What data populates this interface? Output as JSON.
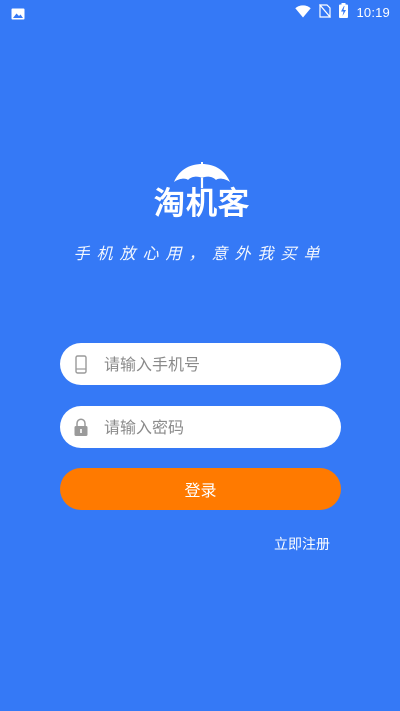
{
  "status_bar": {
    "time": "10:19",
    "icons": [
      "image-icon",
      "wifi-icon",
      "no-sim-icon",
      "battery-charging-icon"
    ]
  },
  "brand": {
    "logo_text": "淘机客",
    "slogan": "手机放心用，意外我买单"
  },
  "form": {
    "phone_placeholder": "请输入手机号",
    "password_placeholder": "请输入密码",
    "phone_icon": "phone-icon",
    "password_icon": "lock-icon",
    "login_label": "登录",
    "register_label": "立即注册"
  },
  "colors": {
    "background": "#3579f6",
    "login_button": "#ff7a00",
    "field_bg": "#ffffff",
    "placeholder": "#8a8a8a"
  }
}
